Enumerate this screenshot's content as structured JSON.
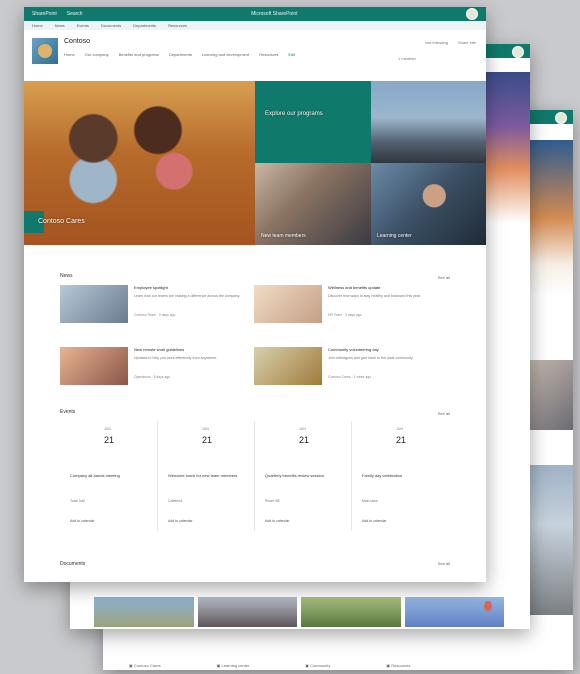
{
  "suitebar": {
    "app": "SharePoint",
    "search": "Search",
    "center": "Microsoft SharePoint"
  },
  "hub": {
    "items": [
      "Home",
      "News",
      "Events",
      "Documents",
      "Departments",
      "Resources"
    ]
  },
  "site": {
    "title": "Contoso",
    "nav": [
      "Home",
      "Our company",
      "Benefits and programs",
      "Departments",
      "Learning and development",
      "Resources",
      "Edit"
    ],
    "actions": [
      "Not following",
      "Share site"
    ],
    "members": "1 member"
  },
  "hero": {
    "big_caption": "Contoso Cares",
    "green_caption": "Explore our programs",
    "office_caption": "New team members",
    "man_caption": "Learning center"
  },
  "news": {
    "title": "News",
    "see_all": "See all",
    "items": [
      {
        "title": "Employee spotlight",
        "desc": "Learn how our teams are making a difference across the company.",
        "meta": "Contoso Team · 2 days ago"
      },
      {
        "title": "Wellness and benefits update",
        "desc": "Discover new ways to stay healthy and balanced this year.",
        "meta": "HR Team · 3 days ago"
      },
      {
        "title": "New remote work guidelines",
        "desc": "Updates to help you work effectively from anywhere.",
        "meta": "Operations · 5 days ago"
      },
      {
        "title": "Community volunteering day",
        "desc": "Join colleagues and give back to the local community.",
        "meta": "Contoso Cares · 1 week ago"
      }
    ]
  },
  "events": {
    "title": "Events",
    "see_all": "See all",
    "items": [
      {
        "month": "JUN",
        "day": "21",
        "title": "Company all-hands meeting",
        "meta": "Town hall",
        "add": "Add to calendar"
      },
      {
        "month": "JUN",
        "day": "21",
        "title": "Welcome lunch for new team members",
        "meta": "Cafeteria",
        "add": "Add to calendar"
      },
      {
        "month": "JUN",
        "day": "21",
        "title": "Quarterly benefits review session",
        "meta": "Room 4B",
        "add": "Add to calendar"
      },
      {
        "month": "JUN",
        "day": "21",
        "title": "Family day celebration",
        "meta": "Main lawn",
        "add": "Add to calendar"
      }
    ]
  },
  "documents": {
    "title": "Documents",
    "see_all": "See all"
  },
  "footer_links": [
    "Contoso Cares",
    "Learning center",
    "Community",
    "Resources"
  ]
}
